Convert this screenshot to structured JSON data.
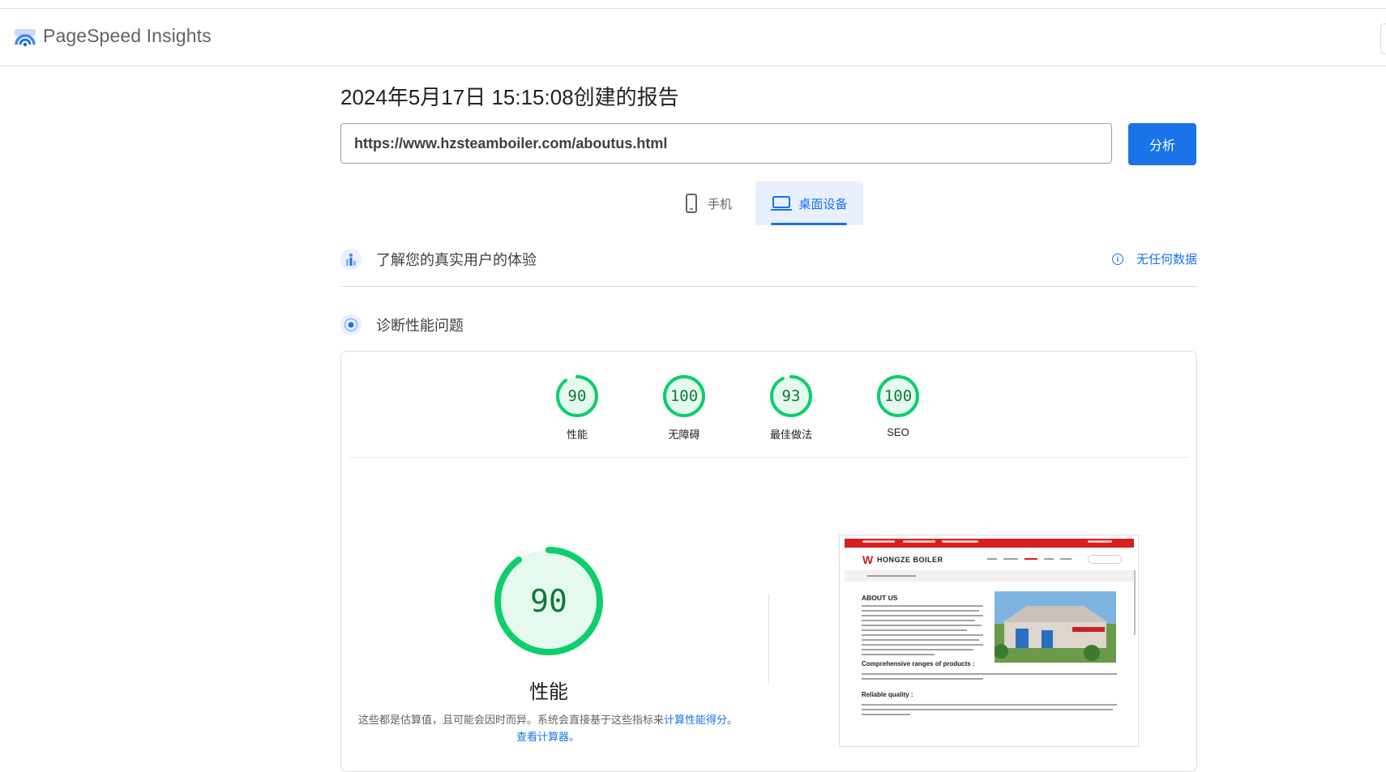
{
  "app": {
    "name": "PageSpeed Insights"
  },
  "report": {
    "title": "2024年5月17日 15:15:08创建的报告",
    "url_value": "https://www.hzsteamboiler.com/aboutus.html",
    "analyze_label": "分析"
  },
  "tabs": [
    {
      "label": "手机",
      "icon": "phone-icon",
      "selected": false
    },
    {
      "label": "桌面设备",
      "icon": "laptop-icon",
      "selected": true
    }
  ],
  "sections": {
    "field_data": {
      "title": "了解您的真实用户的体验",
      "status": "无任何数据",
      "icon": "people-chart-icon"
    },
    "diagnose": {
      "title": "诊断性能问题",
      "icon": "gauge-dot-icon"
    }
  },
  "scores": [
    {
      "label": "性能",
      "value": "90",
      "fraction": 0.9
    },
    {
      "label": "无障碍",
      "value": "100",
      "fraction": 1.0
    },
    {
      "label": "最佳做法",
      "value": "93",
      "fraction": 0.93
    },
    {
      "label": "SEO",
      "value": "100",
      "fraction": 1.0
    }
  ],
  "performance": {
    "score": "90",
    "fraction": 0.9,
    "label": "性能",
    "note_text": "这些都是估算值，且可能会因时而异。系统会直接基于这些指标来",
    "note_link1": "计算性能得分",
    "note_mid": "。",
    "note_link2": "查看计算器",
    "note_end": "。"
  },
  "screenshot": {
    "site_name": "HONGZE BOILER",
    "heading1": "ABOUT US",
    "heading2": "Comprehensive ranges of products :",
    "heading3": "Reliable quality :"
  },
  "colors": {
    "accent": "#1a73e8",
    "score_good": "#0cce6b",
    "score_good_text": "#0c7a38",
    "score_good_bg": "#e6f9ee"
  }
}
